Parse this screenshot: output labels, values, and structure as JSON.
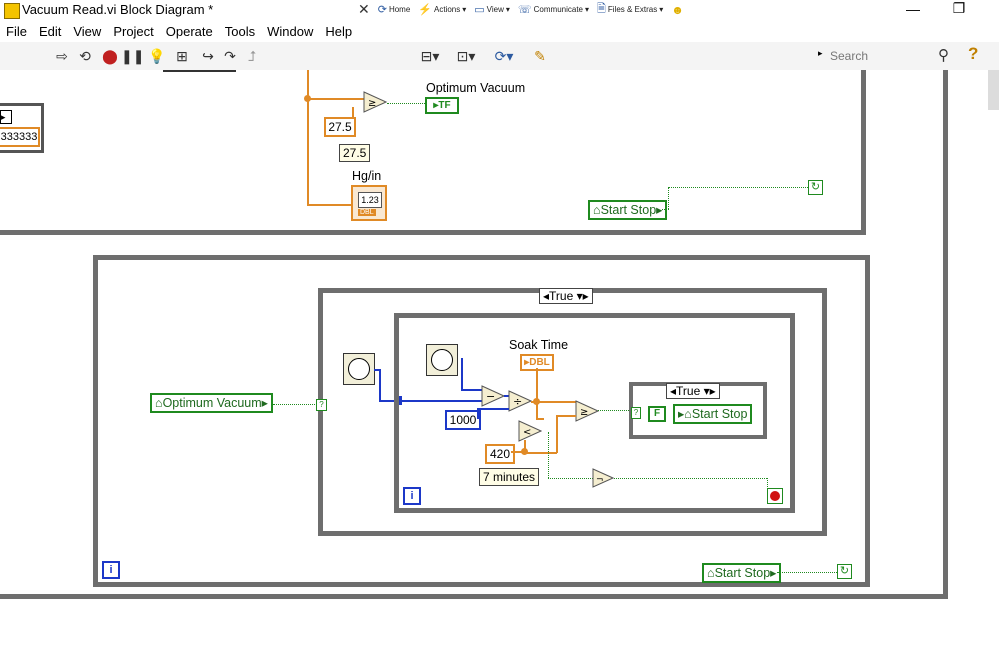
{
  "window": {
    "title": "Vacuum Read.vi Block Diagram *"
  },
  "quickbar": [
    {
      "label": "Home",
      "icon": "home-icon"
    },
    {
      "label": "Actions",
      "icon": "lightning-icon"
    },
    {
      "label": "View",
      "icon": "view-icon"
    },
    {
      "label": "Communicate",
      "icon": "phone-icon"
    },
    {
      "label": "Files & Extras",
      "icon": "files-icon"
    }
  ],
  "menu": [
    "File",
    "Edit",
    "View",
    "Project",
    "Operate",
    "Tools",
    "Window",
    "Help"
  ],
  "toolbar": {
    "font": "15pt Application Font",
    "search_placeholder": "Search"
  },
  "diagram": {
    "top": {
      "const_left": "333333",
      "const_275": "27.5",
      "label_275": "27.5",
      "indicator_optimum": "Optimum Vacuum",
      "indicator_optimum_tf": "TF",
      "hg_label": "Hg/in",
      "hg_value": "1.23",
      "hg_type": "DBL",
      "local_start_stop": "Start Stop"
    },
    "bottom": {
      "case_outer": "True",
      "case_inner": "True",
      "local_optimum": "Optimum Vacuum",
      "soak_label": "Soak Time",
      "soak_type": "DBL",
      "const_1000": "1000",
      "const_420": "420",
      "label_7min": "7 minutes",
      "bool_false": "F",
      "local_start_stop_inner": "Start Stop",
      "local_start_stop_outer": "Start Stop",
      "iter_symbol": "i"
    }
  },
  "colors": {
    "double": "#e08a26",
    "integer": "#1c38c8",
    "boolean": "#1f8a1f",
    "frame": "#6e6e6e"
  }
}
